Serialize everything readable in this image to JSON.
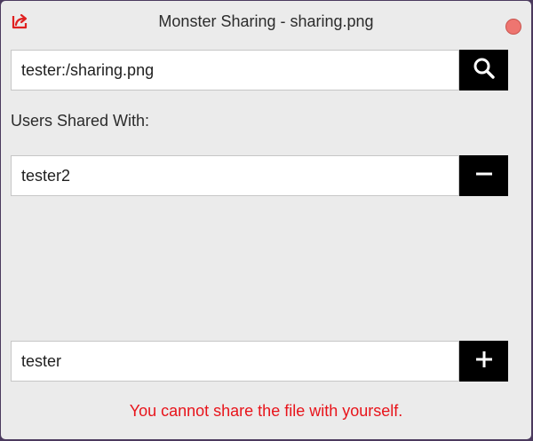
{
  "window": {
    "title": "Monster Sharing - sharing.png"
  },
  "path_field": {
    "value": "tester:/sharing.png"
  },
  "shared_section": {
    "label": "Users Shared With:",
    "users": [
      "tester2"
    ]
  },
  "add_user_field": {
    "value": "tester"
  },
  "error_message": "You cannot share the file with yourself.",
  "icons": {
    "app": "share-icon",
    "search": "search-icon",
    "remove": "minus-icon",
    "add": "plus-icon"
  },
  "colors": {
    "error": "#e8141b",
    "close_button": "#ee7570",
    "app_icon": "#e02020"
  }
}
